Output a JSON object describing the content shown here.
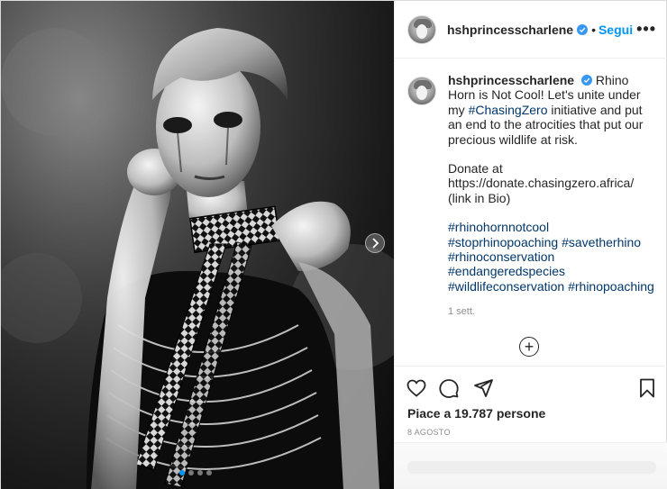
{
  "header": {
    "username": "hshprincesscharlene",
    "separator": "•",
    "follow_label": "Segui",
    "more_label": "•••"
  },
  "caption": {
    "username": "hshprincesscharlene",
    "line1_text": "Rhino Horn is Not Cool! Let's unite under my",
    "line1_tag": "#ChasingZero",
    "line1_tail": "initiative and put an end to the atrocities that put our precious wildlife at risk.",
    "donate_text": "Donate at https://donate.chasingzero.africa/ (link in Bio)",
    "hashtags": [
      "#rhinohornnotcool",
      "#stoprhinopoaching",
      "#savetherhino",
      "#rhinoconservation",
      "#endangeredspecies",
      "#wildlifeconservation",
      "#rhinopoaching"
    ],
    "time_ago": "1 sett."
  },
  "load_more_label": "+",
  "likes_text": "Piace a 19.787 persone",
  "date_text": "8 AGOSTO",
  "carousel": {
    "count": 4,
    "active_index": 0
  },
  "colors": {
    "accent": "#0095f6",
    "hashtag": "#00376b",
    "muted": "#8e8e8e",
    "text": "#262626"
  },
  "icons": {
    "like": "heart-icon",
    "comment": "comment-icon",
    "share": "paper-plane-icon",
    "save": "bookmark-icon",
    "verified": "verified-badge-icon",
    "next": "chevron-right-icon",
    "more": "more-options-icon",
    "add": "plus-circle-icon"
  }
}
